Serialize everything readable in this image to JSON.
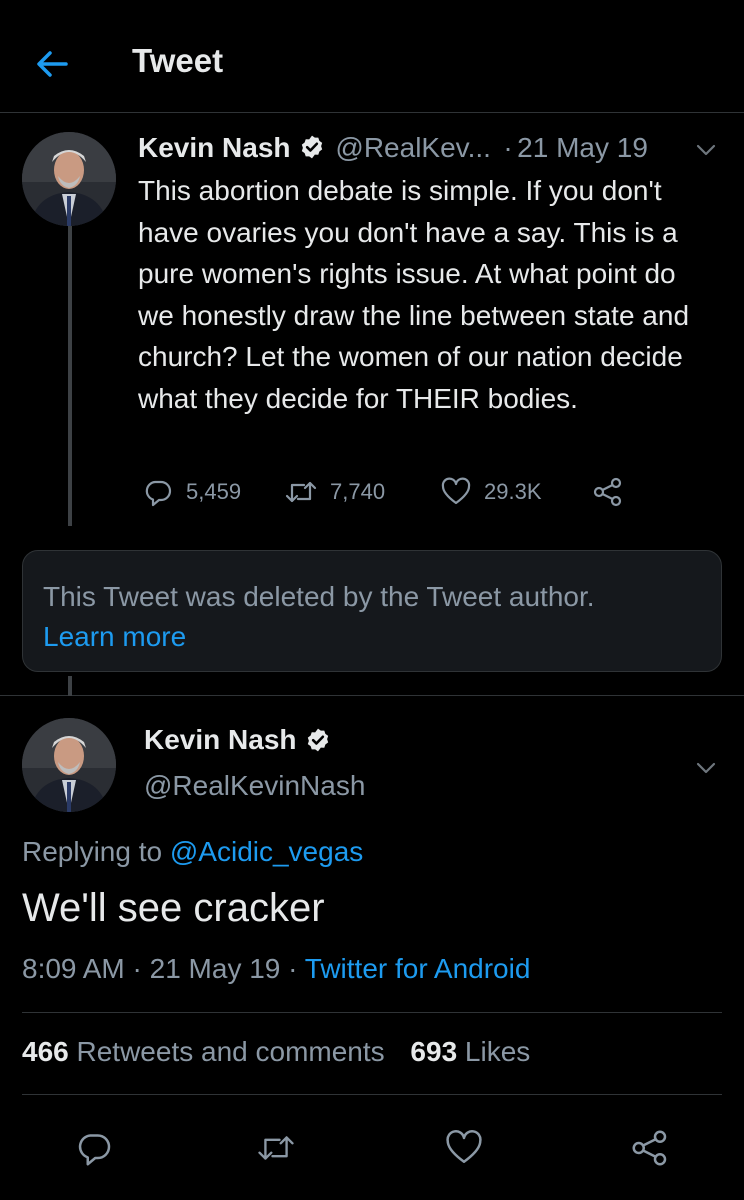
{
  "header": {
    "title": "Tweet"
  },
  "parent_tweet": {
    "name": "Kevin Nash",
    "handle": "@RealKev...",
    "dot": "·",
    "date": "21 May 19",
    "text": "This abortion debate is simple. If you don't have ovaries you don't have a say. This is a pure women's rights issue. At what point do we honestly draw the line between state and church? Let the women of our nation decide what they decide for THEIR bodies.",
    "replies": "5,459",
    "retweets": "7,740",
    "likes": "29.3K"
  },
  "deleted_notice": {
    "text": "This Tweet was deleted by the Tweet author.",
    "link": "Learn more"
  },
  "main_tweet": {
    "name": "Kevin Nash",
    "handle": "@RealKevinNash",
    "replying_label": "Replying to",
    "replying_to": "@Acidic_vegas",
    "text": "We'll see cracker",
    "time": "8:09 AM",
    "dot": "·",
    "date": "21 May 19",
    "source": "Twitter for Android",
    "retweets_count": "466",
    "retweets_label": "Retweets and comments",
    "likes_count": "693",
    "likes_label": "Likes"
  },
  "colors": {
    "background": "#000000",
    "accent": "#1d9bf0",
    "secondary_text": "#8b98a5",
    "primary_text": "#e7e9ea",
    "border": "#2f3336"
  },
  "icons": [
    "back-arrow-icon",
    "verified-badge-icon",
    "chevron-down-icon",
    "reply-icon",
    "retweet-icon",
    "like-icon",
    "share-icon"
  ]
}
